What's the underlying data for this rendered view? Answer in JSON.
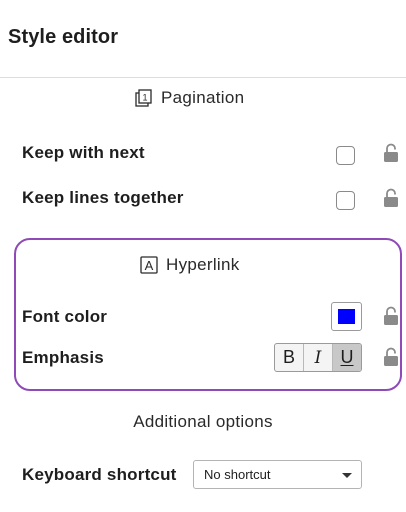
{
  "header": {
    "title": "Style editor"
  },
  "pagination": {
    "title": "Pagination",
    "icon": "pagination-icon",
    "icon_glyph": "1",
    "rows": [
      {
        "label": "Keep with next",
        "checked": false,
        "locked": false
      },
      {
        "label": "Keep lines together",
        "checked": false,
        "locked": false
      }
    ]
  },
  "hyperlink": {
    "title": "Hyperlink",
    "icon": "hyperlink-icon",
    "icon_glyph": "A",
    "border_color": "#8e4ab8",
    "font_color": {
      "label": "Font color",
      "value": "#0000ff"
    },
    "emphasis": {
      "label": "Emphasis",
      "bold_label": "B",
      "italic_label": "I",
      "underline_label": "U",
      "active": "underline"
    }
  },
  "additional": {
    "title": "Additional options",
    "keyboard_shortcut": {
      "label": "Keyboard shortcut",
      "value": "No shortcut"
    }
  }
}
